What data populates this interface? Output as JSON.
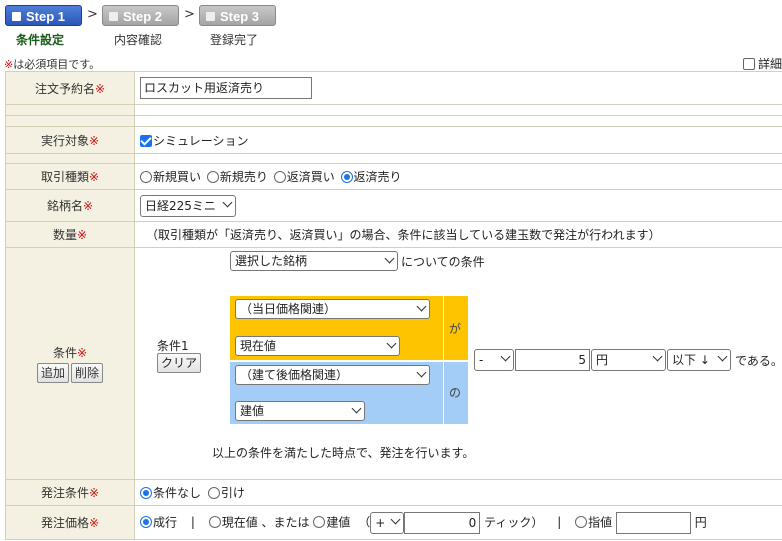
{
  "steps": [
    {
      "label": "Step 1",
      "caption": "条件設定"
    },
    {
      "label": "Step 2",
      "caption": "内容確認"
    },
    {
      "label": "Step 3",
      "caption": "登録完了"
    }
  ],
  "step_arrow": ">",
  "required_mark": "※",
  "required_note": "は必須項目です。",
  "detail_label": "詳細",
  "rows": {
    "order_name": {
      "label": "注文予約名",
      "value": "ロスカット用返済売り"
    },
    "target": {
      "label": "実行対象",
      "value": "シミュレーション"
    },
    "trade_type": {
      "label": "取引種類",
      "options": [
        "新規買い",
        "新規売り",
        "返済買い",
        "返済売り"
      ],
      "selected": "返済売り"
    },
    "symbol": {
      "label": "銘柄名",
      "value": "日経225ミニ"
    },
    "quantity": {
      "label": "数量",
      "text": "（取引種類が「返済売り、返済買い」の場合、条件に該当している建玉数で発注が行われます）"
    },
    "condition": {
      "label": "条件",
      "add": "追加",
      "delete": "削除",
      "cond_no": "条件1",
      "clear": "クリア",
      "subject_select": "選択した銘柄",
      "subject_suffix": "についての条件",
      "left_group": "（当日価格関連）",
      "left_item": "現在値",
      "particle_ga": "が",
      "right_group": "（建て後価格関連）",
      "right_item": "建値",
      "particle_no": "の",
      "sign": "-",
      "amount": "5",
      "unit": "円",
      "comparator": "以下 ↓",
      "end_text": "である。",
      "footer": "以上の条件を満たした時点で、発注を行います。"
    },
    "order_condition": {
      "label": "発注条件",
      "options": [
        "条件なし",
        "引け"
      ],
      "selected": "条件なし"
    },
    "order_price": {
      "label": "発注価格",
      "market": "成行",
      "sep": "|",
      "current_or": "現在値 、または",
      "entry_price": "建値",
      "paren_open": "（",
      "sign": "+",
      "ticks": "0",
      "tick_label": "ティック",
      "paren_close": "）",
      "limit": "指値",
      "yen": "円"
    }
  },
  "colors": {
    "step_active": "#2b57b9",
    "step_inactive": "#a4a4a4",
    "required": "#d01010",
    "label_bg": "#f4f1e2",
    "yellow": "#ffc400",
    "blue": "#a3cdf7"
  }
}
